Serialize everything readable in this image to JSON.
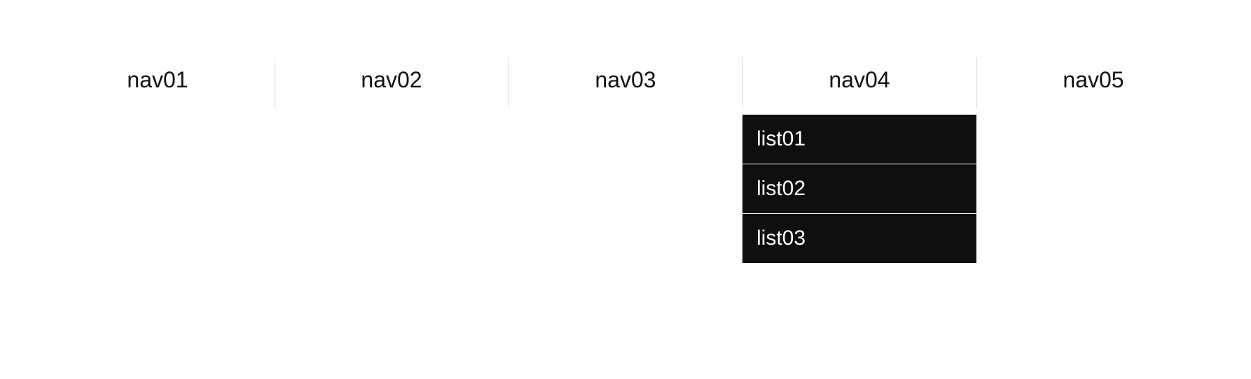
{
  "nav": {
    "items": [
      {
        "label": "nav01"
      },
      {
        "label": "nav02"
      },
      {
        "label": "nav03"
      },
      {
        "label": "nav04"
      },
      {
        "label": "nav05"
      }
    ]
  },
  "dropdown": {
    "items": [
      {
        "label": "list01"
      },
      {
        "label": "list02"
      },
      {
        "label": "list03"
      }
    ]
  }
}
